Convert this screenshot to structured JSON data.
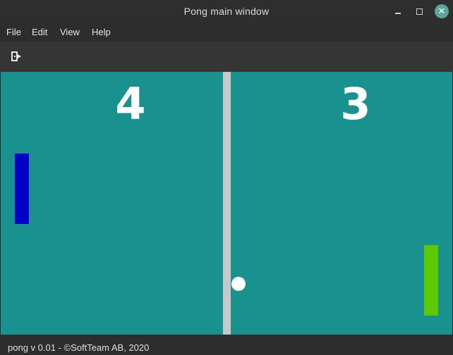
{
  "window": {
    "title": "Pong main window",
    "minimize_icon": "minimize-icon",
    "maximize_icon": "maximize-icon",
    "close_icon": "close-icon"
  },
  "menubar": {
    "items": [
      {
        "label": "File"
      },
      {
        "label": "Edit"
      },
      {
        "label": "View"
      },
      {
        "label": "Help"
      }
    ]
  },
  "toolbar": {
    "exit_icon": "exit-door-icon"
  },
  "game": {
    "left_score": "4",
    "right_score": "3",
    "colors": {
      "court": "#18918f",
      "net": "#c8c8c8",
      "left_paddle": "#0000c8",
      "right_paddle": "#5ec800",
      "ball": "#ffffff"
    }
  },
  "statusbar": {
    "text": "pong v 0.01 - ©SoftTeam AB, 2020"
  }
}
